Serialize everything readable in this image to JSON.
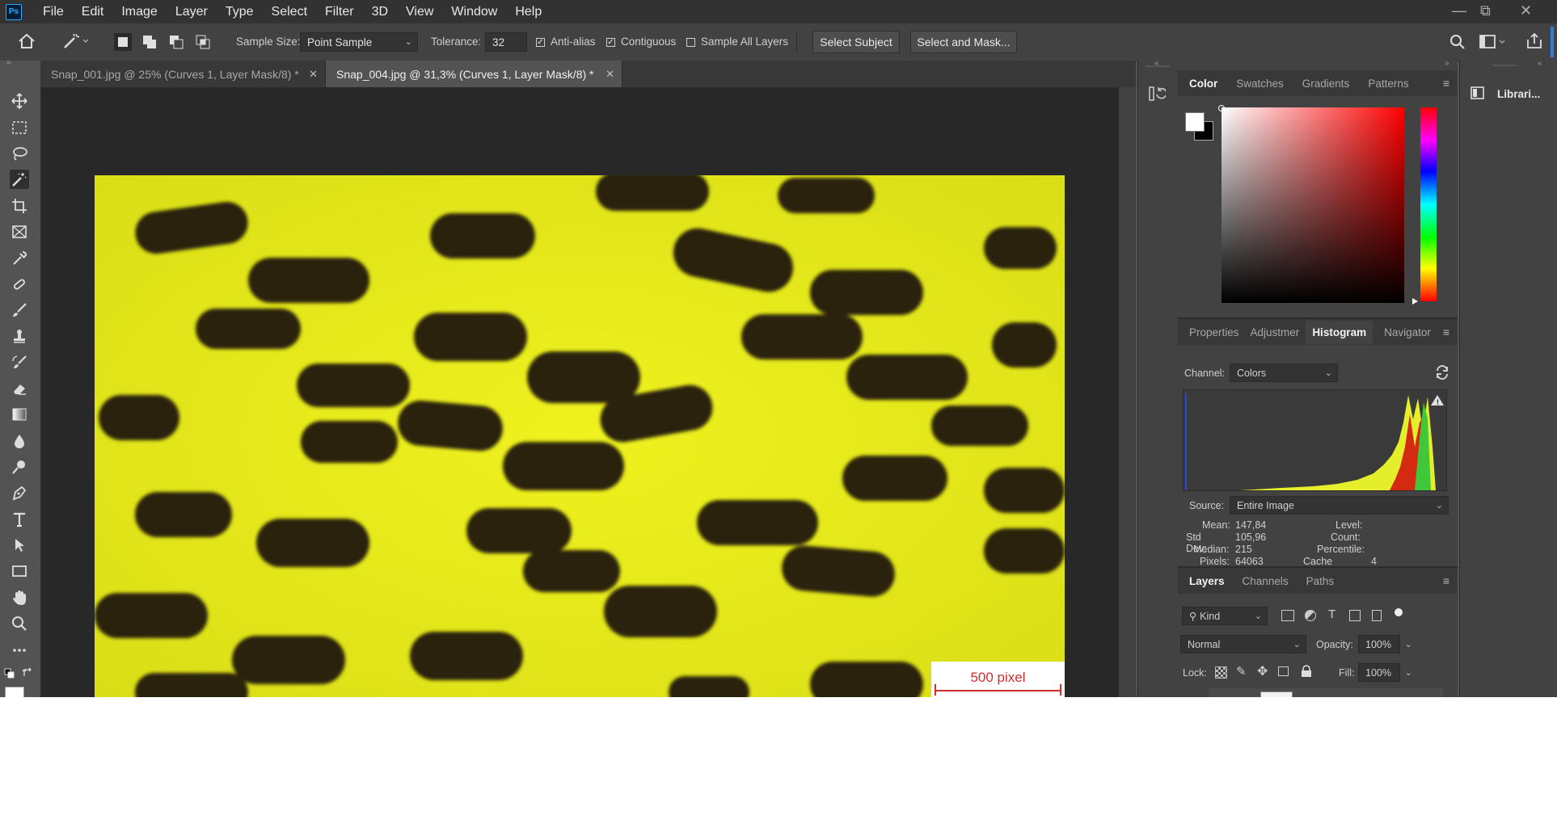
{
  "app": {
    "logo": "Ps"
  },
  "menu": [
    "File",
    "Edit",
    "Image",
    "Layer",
    "Type",
    "Select",
    "Filter",
    "3D",
    "View",
    "Window",
    "Help"
  ],
  "window_controls": {
    "minimize": "—",
    "restore": "⧉",
    "close": "✕"
  },
  "options": {
    "sample_size_label": "Sample Size:",
    "sample_size_value": "Point Sample",
    "tolerance_label": "Tolerance:",
    "tolerance_value": "32",
    "anti_alias_label": "Anti-alias",
    "anti_alias_checked": true,
    "contiguous_label": "Contiguous",
    "contiguous_checked": true,
    "sample_all_layers_label": "Sample All Layers",
    "sample_all_layers_checked": false,
    "select_subject_label": "Select Subject",
    "select_and_mask_label": "Select and Mask..."
  },
  "tabs": [
    {
      "label": "Snap_001.jpg @ 25% (Curves 1, Layer Mask/8) *",
      "active": false
    },
    {
      "label": "Snap_004.jpg @ 31,3% (Curves 1, Layer Mask/8) *",
      "active": true
    }
  ],
  "tools": [
    "move-tool",
    "marquee-tool",
    "lasso-tool",
    "magic-wand-tool",
    "crop-tool",
    "frame-tool",
    "eyedropper-tool",
    "healing-brush-tool",
    "brush-tool",
    "clone-stamp-tool",
    "history-brush-tool",
    "eraser-tool",
    "gradient-tool",
    "blur-tool",
    "dodge-tool",
    "pen-tool",
    "type-tool",
    "path-selection-tool",
    "rectangle-tool",
    "hand-tool",
    "zoom-tool",
    "more-tools"
  ],
  "document": {
    "scale_label": "500 pixel",
    "colors": {
      "background": "#e3e81a",
      "blob": "#2b2410",
      "scalebar": "#d12e2e"
    }
  },
  "color_panel": {
    "tabs": [
      "Color",
      "Swatches",
      "Gradients",
      "Patterns"
    ],
    "active_tab": "Color",
    "foreground": "#ffffff",
    "background": "#000000",
    "hue": "#ff0000"
  },
  "histogram_panel": {
    "tabs": [
      "Properties",
      "Adjustmer",
      "Histogram",
      "Navigator"
    ],
    "active_tab": "Histogram",
    "channel_label": "Channel:",
    "channel_value": "Colors",
    "source_label": "Source:",
    "source_value": "Entire Image",
    "stats_left": [
      {
        "label": "Mean:",
        "value": "147,84"
      },
      {
        "label": "Std Dev:",
        "value": "105,96"
      },
      {
        "label": "Median:",
        "value": "215"
      },
      {
        "label": "Pixels:",
        "value": "64063"
      }
    ],
    "stats_right": [
      {
        "label": "Level:",
        "value": ""
      },
      {
        "label": "Count:",
        "value": ""
      },
      {
        "label": "Percentile:",
        "value": ""
      },
      {
        "label": "Cache Level:",
        "value": "4"
      }
    ]
  },
  "layers_panel": {
    "tabs": [
      "Layers",
      "Channels",
      "Paths"
    ],
    "active_tab": "Layers",
    "kind_label": "Kind",
    "blend_mode": "Normal",
    "opacity_label": "Opacity:",
    "opacity_value": "100%",
    "lock_label": "Lock:",
    "fill_label": "Fill:",
    "fill_value": "100%"
  },
  "libraries": {
    "label": "Librari..."
  }
}
